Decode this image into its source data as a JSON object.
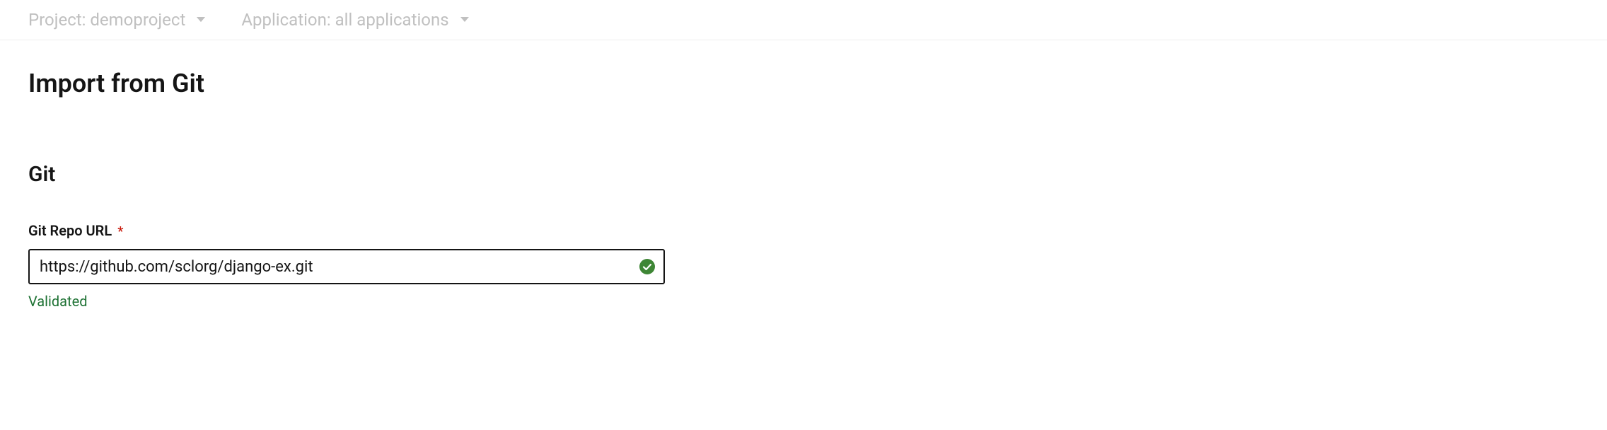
{
  "topbar": {
    "project": {
      "label": "Project: demoproject"
    },
    "application": {
      "label": "Application: all applications"
    }
  },
  "page": {
    "title": "Import from Git"
  },
  "git": {
    "section_title": "Git",
    "url_field": {
      "label": "Git Repo URL",
      "required_mark": "*",
      "value": "https://github.com/sclorg/django-ex.git",
      "validation_message": "Validated"
    }
  },
  "colors": {
    "success": "#3e8635",
    "required": "#c9190b"
  }
}
